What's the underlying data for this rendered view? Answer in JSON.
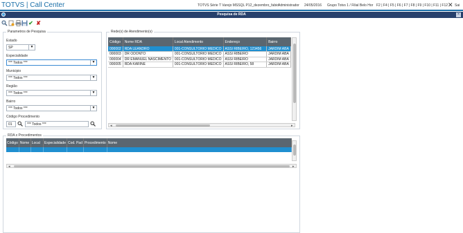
{
  "app": {
    "title": "TOTVS | Call Center",
    "product": "TOTVS Série T Varejo MSSQL P12_dezembro_fabio",
    "user": "Administrador",
    "date": "24/05/2016",
    "company": "Grupo Totvs 1 / Filial Belo Hor",
    "shortcuts": "F2 | F4 | F5 | F6 | F7 | F8 | F9 | F10 | F11 | F12",
    "exit_label": "Sai"
  },
  "dialog": {
    "title": "Pesquisa de RDA",
    "close_glyph": "×"
  },
  "toolbar": {
    "icons": [
      "search-icon",
      "add-icon",
      "print-icon",
      "save-icon",
      "confirm-icon",
      "cancel-icon"
    ],
    "confirm_glyph": "✔",
    "cancel_glyph": "✘"
  },
  "params": {
    "group_label": "Parametros de Pesquisa",
    "estado_label": "Estado",
    "estado_value": "SP",
    "especialidade_label": "Especialidade",
    "especialidade_value": "*** Todos ***",
    "municipio_label": "Municipio",
    "municipio_value": "*** Todos ***",
    "regiao_label": "Região",
    "regiao_value": "*** Todos ***",
    "bairro_label": "Bairro",
    "bairro_value": "*** Todos ***",
    "codproc_label": "Código Procedimento",
    "codproc_value": "01",
    "proc_value": "*** Todos ***"
  },
  "rede": {
    "group_label": "Rede(s) de Atendimento(s)",
    "columns": [
      "Código",
      "Nome RDA",
      "Local Atendimento",
      "Endereço",
      "Bairro"
    ],
    "rows": [
      [
        "000002",
        "RDA LEANDRO",
        "001-CONSULTORIO MEDICO",
        "ASSI RIBEIRO, 123456",
        "JARDIM ABA"
      ],
      [
        "000003",
        "DR ODONTO",
        "001-CONSULTORIO MEDICO",
        "ASSI RIBEIRO",
        "JARDIM ABA"
      ],
      [
        "000004",
        "DR EMANUEL NASCIMENTO",
        "001-CONSULTORIO MEDICO",
        "ASSI RIBEIRO",
        "JARDIM ABA"
      ],
      [
        "000005",
        "RDA KARINE",
        "001-CONSULTORIO MEDICO",
        "ASSI RIBEIRO, 58",
        "JARDIM ABA"
      ]
    ]
  },
  "rdaproc": {
    "group_label": "RDA x Procedimentos",
    "columns": [
      "Código",
      "Nome",
      "Local",
      "Especialidade",
      "Cod. Pad",
      "Procedimento",
      "Nome"
    ]
  },
  "colors": {
    "accent": "#1a6fa8",
    "dialog_bar": "#27406c",
    "selection": "#1f8fd0",
    "grid_header": "#5a6670"
  }
}
